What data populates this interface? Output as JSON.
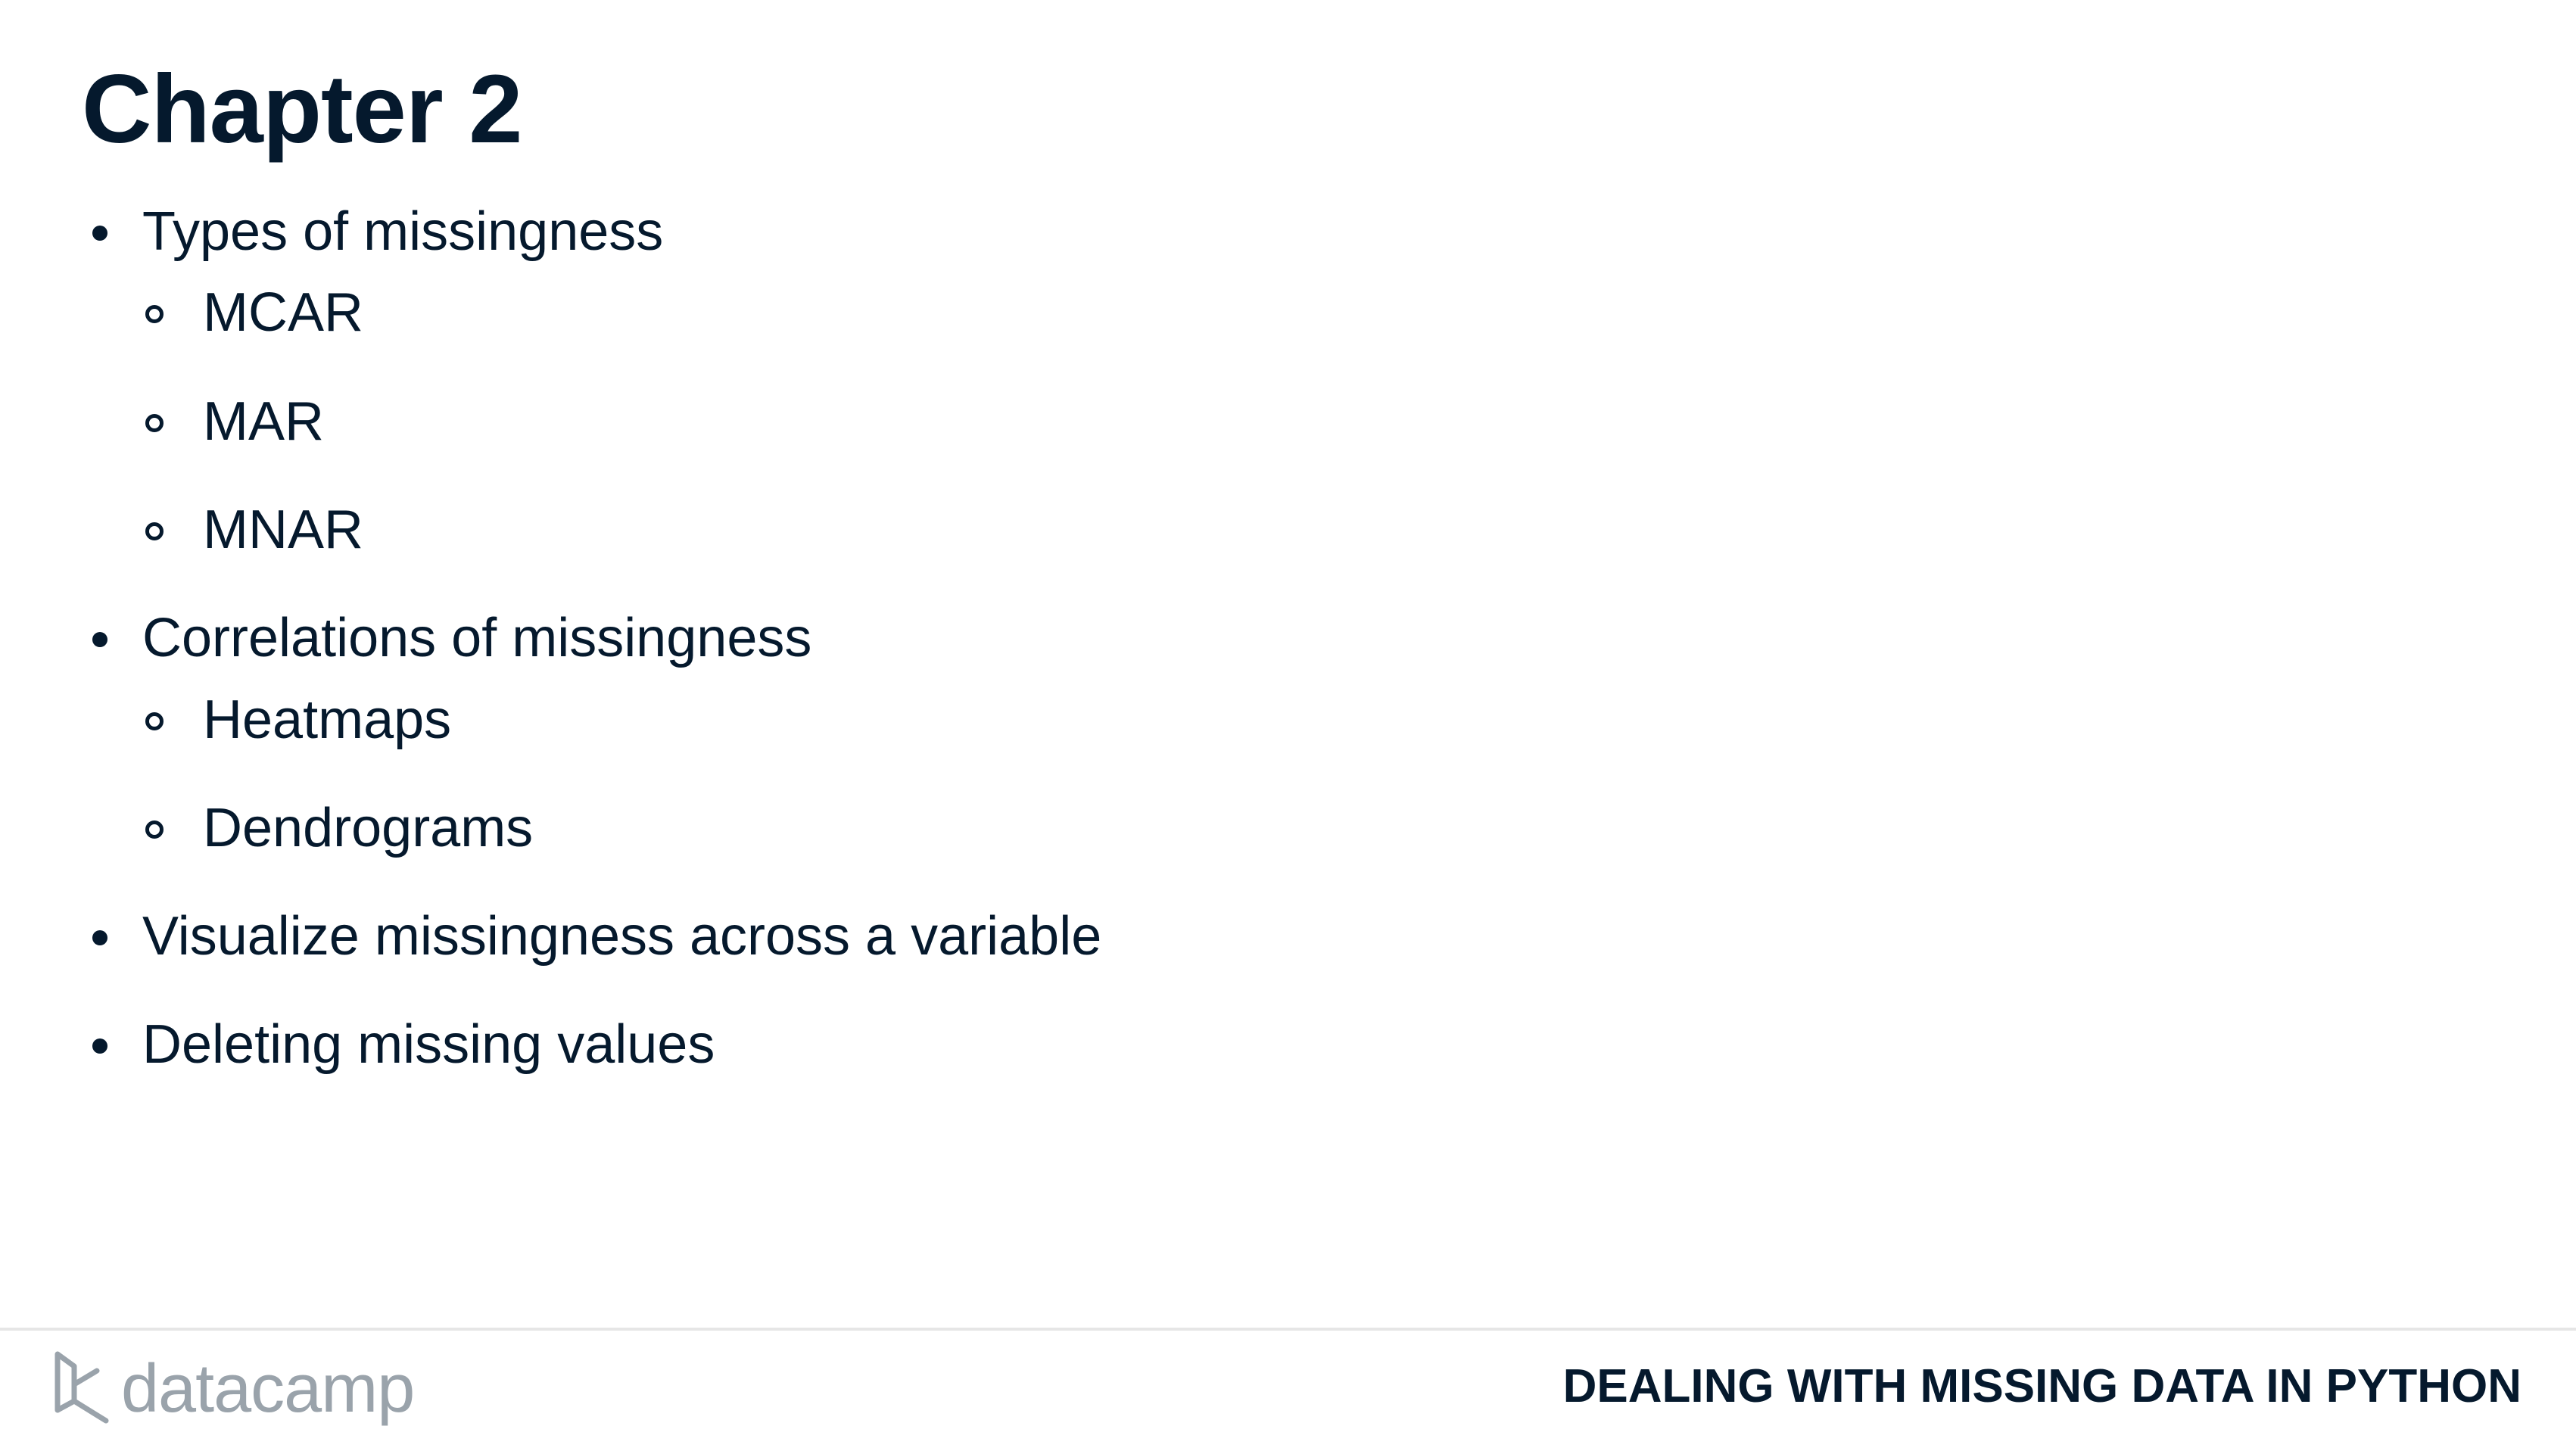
{
  "slide": {
    "title": "Chapter 2",
    "bullets": [
      {
        "label": "Types of missingness"
      },
      {
        "label": "MCAR"
      },
      {
        "label": "MAR"
      },
      {
        "label": "MNAR"
      },
      {
        "label": "Correlations of missingness"
      },
      {
        "label": "Heatmaps"
      },
      {
        "label": "Dendrograms"
      },
      {
        "label": "Visualize missingness across a variable"
      },
      {
        "label": "Deleting missing values"
      }
    ]
  },
  "footer": {
    "logo_text": "datacamp",
    "logo_icon": "datacamp-logo-icon",
    "course_title": "DEALING WITH MISSING DATA IN PYTHON"
  },
  "colors": {
    "text": "#05192d",
    "logo": "#9aa3ab",
    "divider": "#e6e6e6"
  }
}
